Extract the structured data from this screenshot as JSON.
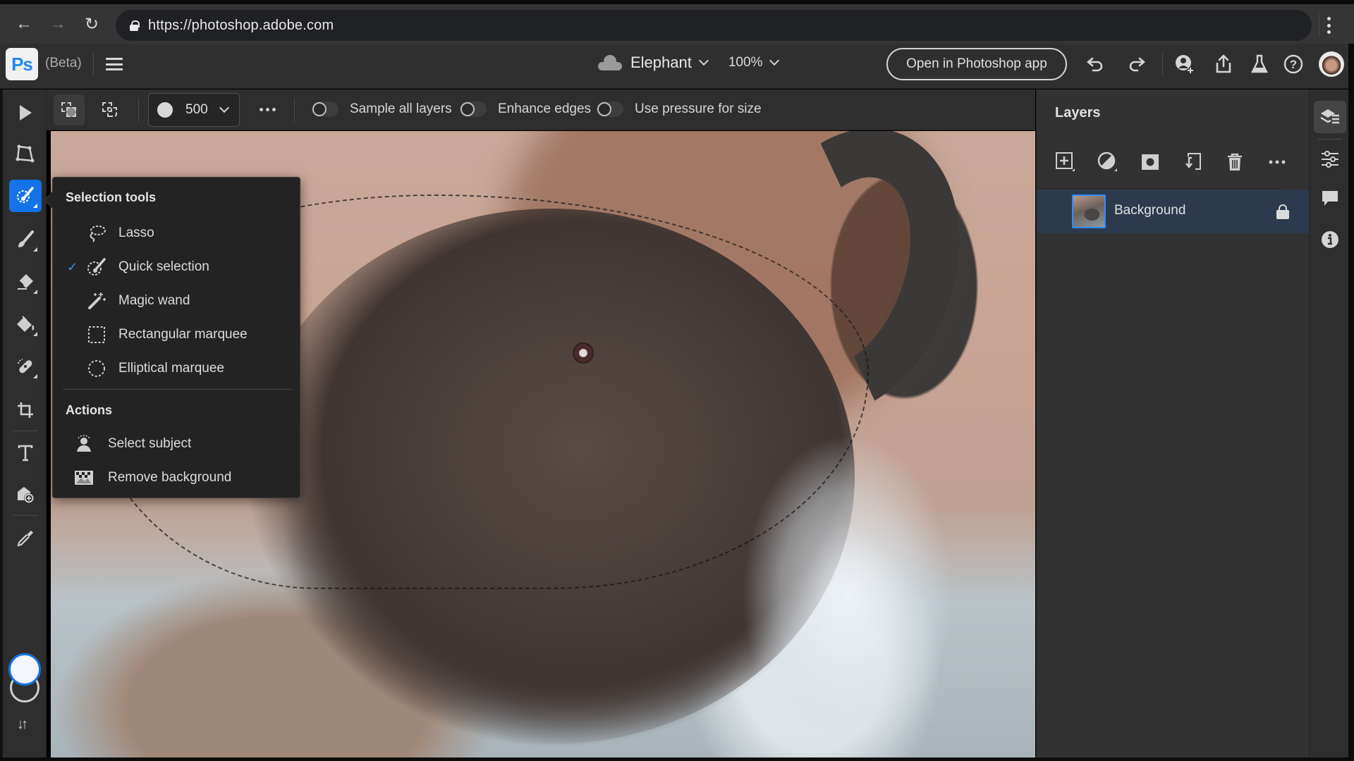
{
  "browser": {
    "url": "https://photoshop.adobe.com",
    "back_icon": "arrow-left-icon",
    "forward_icon": "arrow-right-icon",
    "reload_icon": "reload-icon",
    "menu_icon": "kebab-menu-icon"
  },
  "app": {
    "logo": "Ps",
    "beta_label": "(Beta)",
    "document_title": "Elephant",
    "zoom_level": "100%",
    "open_in_app_label": "Open in Photoshop app",
    "header_icons": [
      "undo-icon",
      "redo-icon",
      "invite-user-icon",
      "share-icon",
      "labs-flask-icon",
      "help-icon",
      "avatar"
    ]
  },
  "options_bar": {
    "brush_size": "500",
    "toggles": [
      {
        "label": "Sample all layers",
        "on": false
      },
      {
        "label": "Enhance edges",
        "on": false
      },
      {
        "label": "Use pressure for size",
        "on": false
      }
    ]
  },
  "toolbar": {
    "tools": [
      {
        "name": "move",
        "icon": "move-arrow-icon",
        "active": false
      },
      {
        "name": "transform",
        "icon": "transform-icon",
        "active": false
      },
      {
        "name": "quick-selection",
        "icon": "quick-selection-icon",
        "active": true
      },
      {
        "name": "brush",
        "icon": "brush-icon",
        "active": false
      },
      {
        "name": "eraser",
        "icon": "eraser-icon",
        "active": false
      },
      {
        "name": "paint-bucket",
        "icon": "paint-bucket-icon",
        "active": false
      },
      {
        "name": "healing",
        "icon": "healing-brush-icon",
        "active": false
      },
      {
        "name": "crop",
        "icon": "crop-icon",
        "active": false
      },
      {
        "name": "type",
        "icon": "type-icon",
        "active": false
      },
      {
        "name": "add-image",
        "icon": "add-image-icon",
        "active": false
      },
      {
        "name": "eyedropper",
        "icon": "eyedropper-icon",
        "active": false
      }
    ],
    "foreground_color": "#f4f6fb",
    "background_color": "transparent"
  },
  "selection_popup": {
    "heading": "Selection tools",
    "items": [
      {
        "label": "Lasso",
        "icon": "lasso-icon",
        "checked": false
      },
      {
        "label": "Quick selection",
        "icon": "quick-selection-icon",
        "checked": true
      },
      {
        "label": "Magic wand",
        "icon": "magic-wand-icon",
        "checked": false
      },
      {
        "label": "Rectangular marquee",
        "icon": "rectangular-marquee-icon",
        "checked": false
      },
      {
        "label": "Elliptical marquee",
        "icon": "elliptical-marquee-icon",
        "checked": false
      }
    ],
    "actions_heading": "Actions",
    "actions": [
      {
        "label": "Select subject",
        "icon": "select-subject-icon"
      },
      {
        "label": "Remove background",
        "icon": "remove-background-icon"
      }
    ]
  },
  "layers_panel": {
    "title": "Layers",
    "actions": [
      "add-layer-icon",
      "adjustment-layer-icon",
      "add-mask-icon",
      "clip-to-below-icon",
      "delete-icon",
      "more-icon"
    ],
    "layers": [
      {
        "name": "Background",
        "locked": true,
        "selected": true
      }
    ]
  },
  "right_strip": {
    "icons": [
      "layers-icon",
      "properties-icon",
      "comments-icon",
      "info-icon"
    ]
  },
  "colors": {
    "accent": "#1473e6",
    "check": "#3a8ef5",
    "selected_layer_bg": "#2d3a4d"
  }
}
